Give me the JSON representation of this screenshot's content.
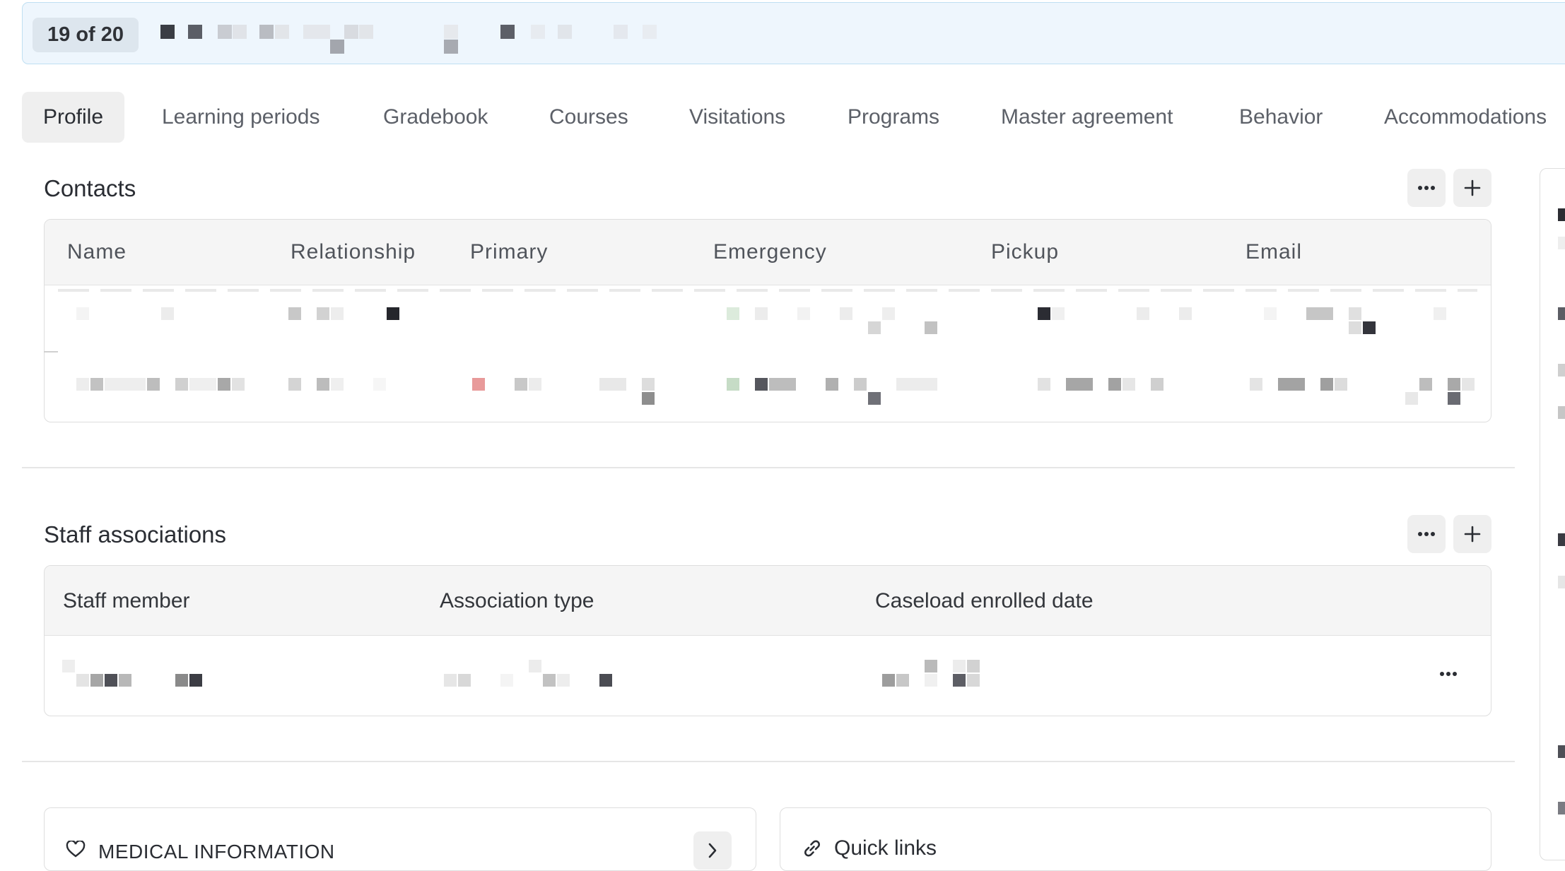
{
  "record_nav": {
    "counter": "19 of 20"
  },
  "tabs": [
    "Profile",
    "Learning periods",
    "Gradebook",
    "Courses",
    "Visitations",
    "Programs",
    "Master agreement",
    "Behavior",
    "Accommodations"
  ],
  "contacts": {
    "title": "Contacts",
    "columns": [
      "Name",
      "Relationship",
      "Primary",
      "Emergency",
      "Pickup",
      "Email"
    ]
  },
  "staff": {
    "title": "Staff associations",
    "columns": [
      "Staff member",
      "Association type",
      "Caseload enrolled date"
    ]
  },
  "cards": {
    "medical_title": "MEDICAL INFORMATION",
    "quick_links_title": "Quick links"
  },
  "colors": {
    "banner_bg": "#eef6fd",
    "banner_border": "#bfdff2",
    "active_tab_bg": "#efefef"
  }
}
